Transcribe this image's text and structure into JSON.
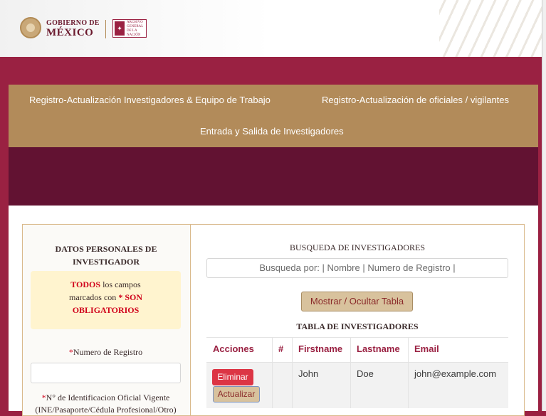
{
  "header": {
    "gob_small": "GOBIERNO DE",
    "gob_big": "MÉXICO",
    "agn_lines": "ARCHIVO GENERAL DE LA NACIÓN"
  },
  "nav": {
    "item1": "Registro-Actualización Investigadores & Equipo de Trabajo",
    "item2": "Registro-Actualización de oficiales / vigilantes",
    "item3": "Entrada y Salida de Investigadores"
  },
  "left_panel": {
    "title_line1": "DATOS PERSONALES DE",
    "title_line2": "INVESTIGADOR",
    "alert_todos": "TODOS",
    "alert_text1": " los campos",
    "alert_text2": "marcados con ",
    "alert_son": "* SON",
    "alert_obligatorios": "OBLIGATORIOS",
    "field1_star": "*",
    "field1_label": "Numero de Registro",
    "field2_star": "*",
    "field2_label": "N° de Identificacion Oficial Vigente",
    "field2_sub": "(INE/Pasaporte/Cédula Profesional/Otro)"
  },
  "right_panel": {
    "search_title": "BUSQUEDA DE INVESTIGADORES",
    "search_placeholder": "Busqueda por: | Nombre | Numero de Registro |",
    "toggle_button": "Mostrar / Ocultar Tabla",
    "table_title": "TABLA DE INVESTIGADORES",
    "columns": [
      "Acciones",
      "#",
      "Firstname",
      "Lastname",
      "Email"
    ],
    "rows": [
      {
        "number": "",
        "firstname": "John",
        "lastname": "Doe",
        "email": "john@example.com",
        "delete_label": "Eliminar",
        "update_label": "Actualizar"
      }
    ]
  },
  "colors": {
    "primary": "#9a2142",
    "dark_band": "#621232",
    "gold": "#b28b5a",
    "alert_bg": "#fff4cf",
    "danger": "#dc3545"
  }
}
